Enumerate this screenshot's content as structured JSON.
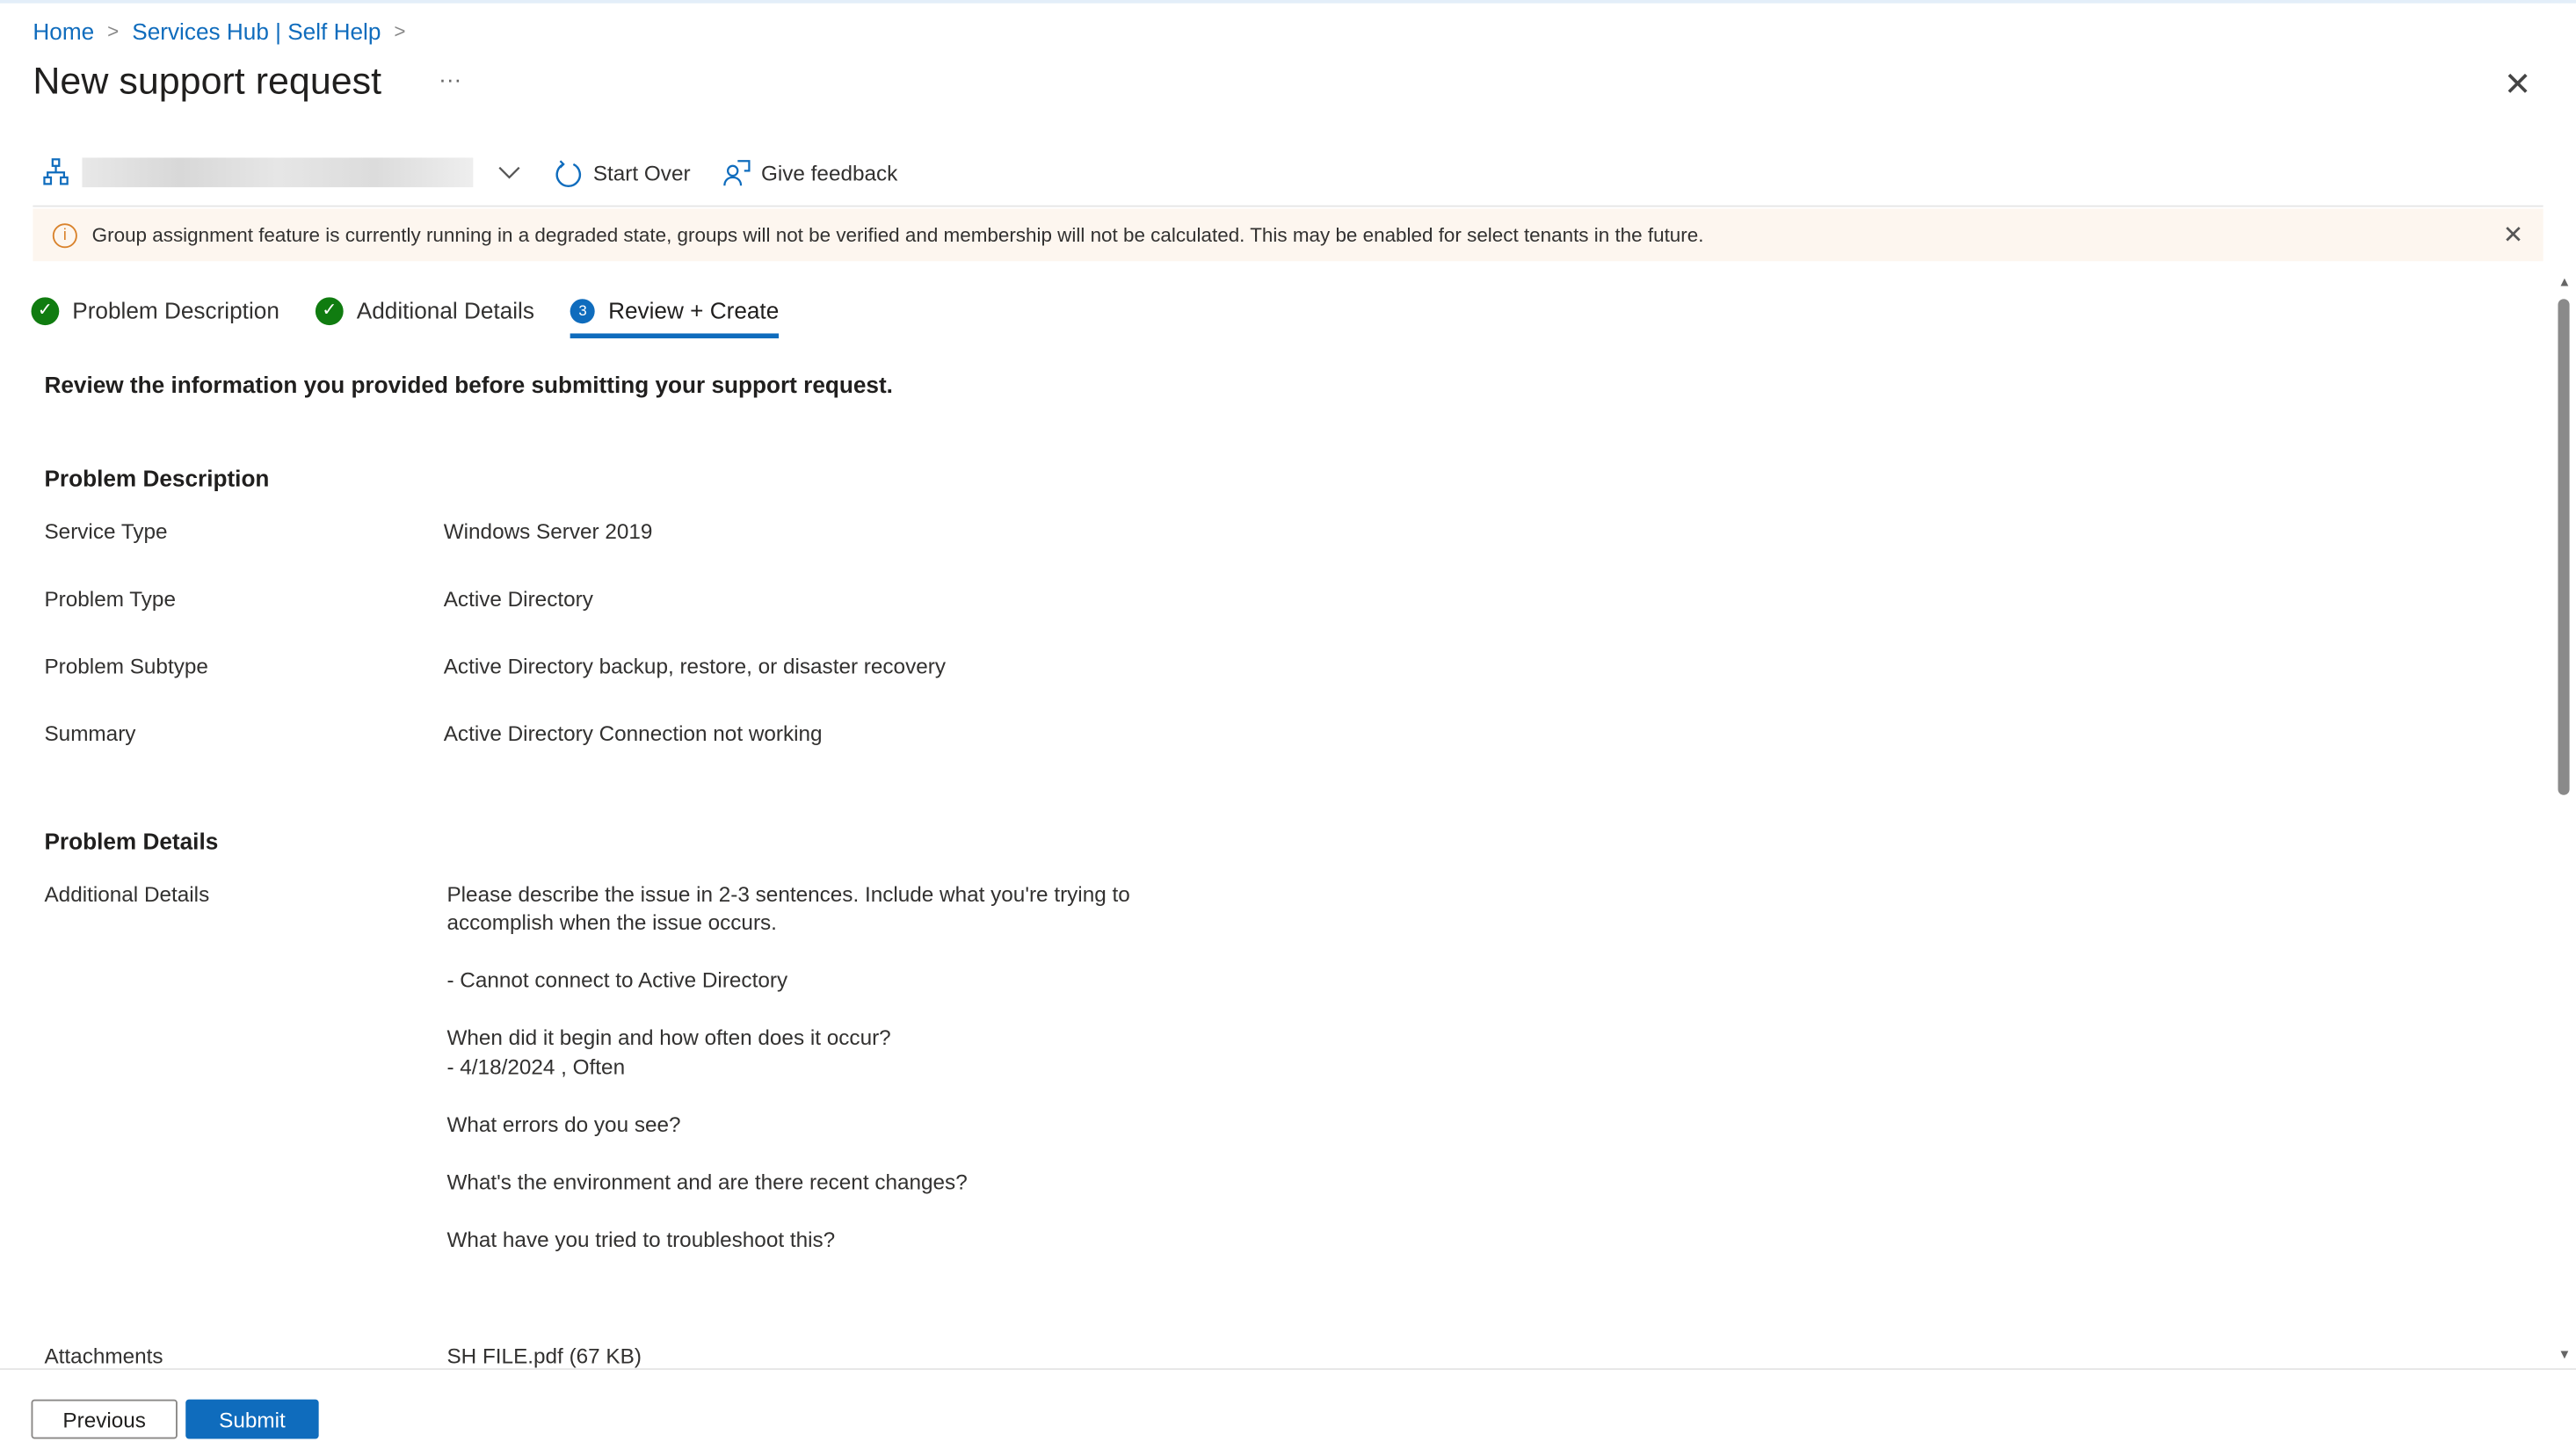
{
  "breadcrumb": {
    "items": [
      "Home",
      "Services Hub | Self Help"
    ]
  },
  "header": {
    "title": "New support request",
    "more": "···",
    "close": "✕"
  },
  "toolbar": {
    "start_over": "Start Over",
    "give_feedback": "Give feedback"
  },
  "banner": {
    "text": "Group assignment feature is currently running in a degraded state, groups will not be verified and membership will not be calculated. This may be enabled for select tenants in the future.",
    "icon": "info-icon",
    "color": "#d9822b"
  },
  "steps": [
    {
      "label": "Problem Description",
      "status": "complete"
    },
    {
      "label": "Additional Details",
      "status": "complete"
    },
    {
      "label": "Review + Create",
      "number": "3",
      "status": "active"
    }
  ],
  "intro": "Review the information you provided before submitting your support request.",
  "problem_description": {
    "heading": "Problem Description",
    "rows": [
      {
        "label": "Service Type",
        "value": "Windows Server 2019"
      },
      {
        "label": "Problem Type",
        "value": "Active Directory"
      },
      {
        "label": "Problem Subtype",
        "value": "Active Directory backup, restore, or disaster recovery"
      },
      {
        "label": "Summary",
        "value": "Active Directory Connection not working"
      }
    ]
  },
  "problem_details": {
    "heading": "Problem Details",
    "label": "Additional Details",
    "lines": [
      "Please describe the issue in 2-3 sentences. Include what you're trying to",
      "accomplish when the issue occurs.",
      "- Cannot connect to Active Directory",
      "When did it begin and how often does it occur?",
      "- 4/18/2024 , Often",
      "What errors do you see?",
      "What's the environment and are there recent changes?",
      "What have you tried to troubleshoot this?"
    ]
  },
  "attachments": {
    "label": "Attachments",
    "value": "SH FILE.pdf (67 KB)"
  },
  "footer": {
    "previous": "Previous",
    "submit": "Submit"
  },
  "colors": {
    "accent": "#0f6cbd",
    "success": "#107c10",
    "warning_bg": "#fdf6ef"
  }
}
